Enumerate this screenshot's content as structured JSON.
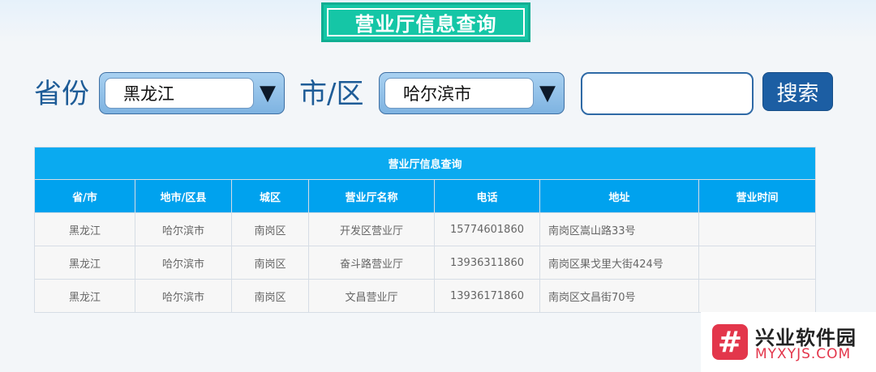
{
  "banner": {
    "title": "营业厅信息查询"
  },
  "search": {
    "province_label": "省份",
    "province_value": "黑龙江",
    "city_label": "市/区",
    "city_value": "哈尔滨市",
    "keyword_value": "",
    "button_label": "搜索",
    "dropdown_arrow": "▼"
  },
  "table": {
    "title": "营业厅信息查询",
    "columns": [
      "省/市",
      "地市/区县",
      "城区",
      "营业厅名称",
      "电话",
      "地址",
      "营业时间"
    ],
    "rows": [
      [
        "黑龙江",
        "哈尔滨市",
        "南岗区",
        "开发区营业厅",
        "15774601860",
        "南岗区嵩山路33号",
        ""
      ],
      [
        "黑龙江",
        "哈尔滨市",
        "南岗区",
        "奋斗路营业厅",
        "13936311860",
        "南岗区果戈里大街424号",
        ""
      ],
      [
        "黑龙江",
        "哈尔滨市",
        "南岗区",
        "文昌营业厅",
        "13936171860",
        "南岗区文昌街70号",
        ""
      ]
    ]
  },
  "watermark": {
    "mark": "#",
    "name_cn": "兴业软件园",
    "name_en": "MYXYJS.COM"
  }
}
